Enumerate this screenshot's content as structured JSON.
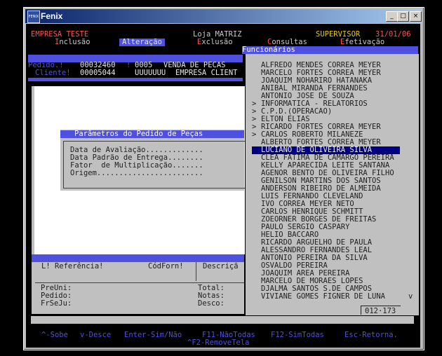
{
  "window": {
    "title": "Fenix",
    "app_icon": "FENIX",
    "controls": [
      "_",
      "□",
      "×"
    ]
  },
  "header": {
    "company": "EMPRESA TESTE",
    "store": "Loja MATRIZ",
    "user": "SUPERVISOR",
    "date": "31/01/06",
    "menu": [
      {
        "hot": "I",
        "rest": "nclusão"
      },
      {
        "hot": "A",
        "rest": "lteração",
        "active": true
      },
      {
        "hot": "E",
        "rest": "xclusão"
      },
      {
        "hot": "C",
        "rest": "onsultas"
      },
      {
        "hot": "E",
        "rest": "fetivação"
      }
    ]
  },
  "order": {
    "pedido_label": "Pedido.!",
    "pedido_value": "00032460",
    "pedido_sep": "!",
    "pedido_code": "0005",
    "pedido_desc": "VENDA DE PECAS",
    "cliente_label": "Cliente!",
    "cliente_value": "00005044",
    "cliente_code": "UUUUUUU",
    "cliente_desc": "EMPRESA CLIENT"
  },
  "dialog": {
    "title": "Parâmetros do Pedido de Peças",
    "fields": [
      "Data de Avaliação.............",
      "Data Padrão de Entrega........",
      "Fator  de Multiplicação.......",
      "Origem........................"
    ]
  },
  "grid_header": {
    "col1": "L! Referência!",
    "col2": "CódForn!",
    "col3": "Descriçã"
  },
  "footer_left": {
    "labels": [
      "PreUni:",
      "Pedido:",
      "FrSeJu:"
    ]
  },
  "footer_right": {
    "labels": [
      "Total:",
      "Notas:",
      "Desco:"
    ]
  },
  "employees": {
    "title": "Funcionários",
    "items": [
      "ALFREDO MENDES CORREA MEYER",
      "MARCELO FORTES CORREA MEYER",
      "JOAQUIM NOHARIRO HATANAKA",
      "ANIBAL MIRANDA FERNANDES",
      "ANTONIO JOSE DE SOUZA",
      "INFORMATICA - RELATORIOS",
      "C.P.D.(OPERACAO)",
      "ELTON ELIAS",
      "RICARDO FORTES CORREA MEYER",
      "CARLOS ROBERTO MILANEZE",
      "ALBERTO FORTES CORREA MEYER",
      "LUCIANO DE OLIVEIRA SILVA",
      "CLEA FATIMA DE CAMARGO PEREIRA",
      "KELLY APARECIDA LEITE SANTANA",
      "AGENOR BENTO DE OLIVEIRA FILHO",
      "GENILSON MARTINS DOS SANTOS",
      "ANDERSON RIBEIRO DE ALMEIDA",
      "LUIS FERNANDO CLEVELAND",
      "IVO CORREA MEYER NETO",
      "CARLOS HENRIQUE SCHMITT",
      "ZOEORNER BORGES DE FREITAS",
      "PAULO SERGIO CASPARY",
      "HELIO BACCARO",
      "RICARDO ARGUELHO DE PAULA",
      "ALESSANDRO FERNANDES LEAL",
      "ANTONIO PEREIRA DA SILVA",
      "OSVALDO PEREIRA",
      "JOAQUIM AREA PEREIRA",
      "MARCELO DE MORAES LOPES",
      "DJALMA SANTOS S.DE CAMPOS",
      "VIVIANE GOMES FIGNER DE LUNA"
    ],
    "arrow_rows": [
      5,
      6,
      7,
      8,
      9
    ],
    "selected": 11,
    "counter": "012·173",
    "scroll_down": "v"
  },
  "hotkeys": {
    "line1": [
      "^-Sobe",
      "v-Desce",
      "Enter-Sim/Não",
      "F11-NãoTodas",
      "F12-SimTodas",
      "Esc-Retorna."
    ],
    "line2": "^F2-RemoveTela"
  }
}
